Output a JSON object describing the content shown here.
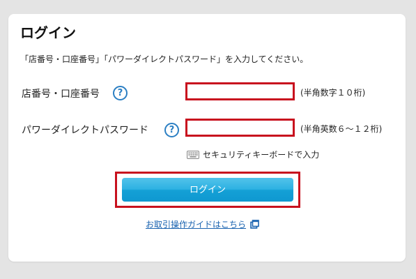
{
  "page": {
    "title": "ログイン",
    "instruction": "「店番号・口座番号」「パワーダイレクトパスワード」を入力してください。"
  },
  "fields": [
    {
      "label": "店番号・口座番号",
      "help_icon": "question-mark-icon",
      "help_glyph": "?",
      "value": "",
      "hint": "(半角数字１０桁)"
    },
    {
      "label": "パワーダイレクトパスワード",
      "help_icon": "question-mark-icon",
      "help_glyph": "?",
      "value": "",
      "hint": "(半角英数６～１２桁)"
    }
  ],
  "keyboard": {
    "icon": "keyboard-icon",
    "label": "セキュリティキーボードで入力"
  },
  "login_button": {
    "label": "ログイン"
  },
  "guide_link": {
    "label": "お取引操作ガイドはこちら",
    "icon": "external-window-icon"
  },
  "colors": {
    "highlight_border": "#c8111e",
    "button_blue": "#14a0d6",
    "link_blue": "#1a63b0",
    "help_icon_blue": "#2b7fc3",
    "background": "#e4e4e4",
    "card": "#ffffff"
  }
}
